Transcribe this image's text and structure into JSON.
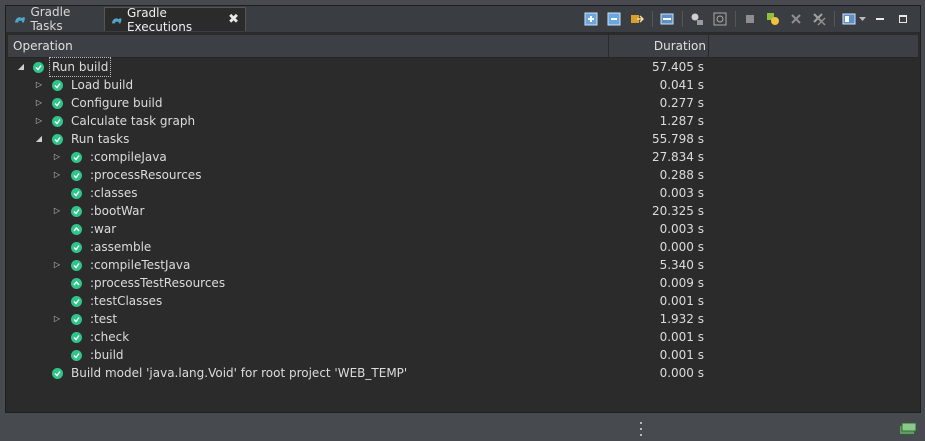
{
  "tabs": [
    {
      "label": "Gradle Tasks"
    },
    {
      "label": "Gradle Executions",
      "close": "✖"
    }
  ],
  "columns": {
    "operation": "Operation",
    "duration": "Duration"
  },
  "rows": [
    {
      "label": "Run build",
      "duration": "57.405 s",
      "twisty": "expanded",
      "status": "success"
    },
    {
      "label": "Load build",
      "duration": "0.041 s",
      "twisty": "collapsed",
      "status": "success"
    },
    {
      "label": "Configure build",
      "duration": "0.277 s",
      "twisty": "collapsed",
      "status": "success"
    },
    {
      "label": "Calculate task graph",
      "duration": "1.287 s",
      "twisty": "collapsed",
      "status": "success"
    },
    {
      "label": "Run tasks",
      "duration": "55.798 s",
      "twisty": "expanded",
      "status": "success"
    },
    {
      "label": ":compileJava",
      "duration": "27.834 s",
      "twisty": "collapsed",
      "status": "success"
    },
    {
      "label": ":processResources",
      "duration": "0.288 s",
      "twisty": "collapsed",
      "status": "success"
    },
    {
      "label": ":classes",
      "duration": "0.003 s",
      "twisty": "none",
      "status": "success"
    },
    {
      "label": ":bootWar",
      "duration": "20.325 s",
      "twisty": "collapsed",
      "status": "success"
    },
    {
      "label": ":war",
      "duration": "0.003 s",
      "twisty": "none",
      "status": "up-to-date"
    },
    {
      "label": ":assemble",
      "duration": "0.000 s",
      "twisty": "none",
      "status": "success"
    },
    {
      "label": ":compileTestJava",
      "duration": "5.340 s",
      "twisty": "collapsed",
      "status": "success"
    },
    {
      "label": ":processTestResources",
      "duration": "0.009 s",
      "twisty": "none",
      "status": "up-to-date"
    },
    {
      "label": ":testClasses",
      "duration": "0.001 s",
      "twisty": "none",
      "status": "success"
    },
    {
      "label": ":test",
      "duration": "1.932 s",
      "twisty": "collapsed",
      "status": "success"
    },
    {
      "label": ":check",
      "duration": "0.001 s",
      "twisty": "none",
      "status": "success"
    },
    {
      "label": ":build",
      "duration": "0.001 s",
      "twisty": "none",
      "status": "success"
    },
    {
      "label": "Build model 'java.lang.Void' for root project 'WEB_TEMP'",
      "duration": "0.000 s",
      "twisty": "none",
      "status": "success"
    }
  ],
  "toolbar_icons": [
    "expand-all-icon",
    "collapse-all-icon",
    "link-with-console-icon",
    "show-console-icon",
    "filter-icon",
    "focus-icon",
    "stop-icon",
    "rerun-icon",
    "remove-icon",
    "remove-all-icon",
    "view-menu-icon",
    "minimize-icon",
    "maximize-icon"
  ],
  "colors": {
    "success": "#2ec48a",
    "background": "#2b2b2b",
    "chrome": "#474b50"
  }
}
